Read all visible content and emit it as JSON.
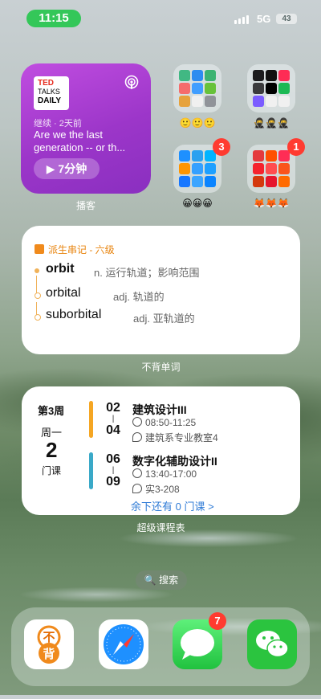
{
  "status_bar": {
    "time": "11:15",
    "network": "5G",
    "battery": "43"
  },
  "podcast_widget": {
    "logo_line1": "TED",
    "logo_line2": "TALKS",
    "logo_line3": "DAILY",
    "subtitle": "继续 · 2天前",
    "title": "Are we the last generation -- or th...",
    "play_label": "▶ 7分钟",
    "label": "播客"
  },
  "folders": [
    {
      "label": "🙂🙂🙂",
      "badge": ""
    },
    {
      "label": "🥷🥷🥷",
      "badge": ""
    },
    {
      "label": "😀😀😀",
      "badge": "3"
    },
    {
      "label": "🦊🦊🦊",
      "badge": "1"
    }
  ],
  "vocab_widget": {
    "header": "派生串记 - 六级",
    "entries": [
      {
        "word": "orbit",
        "definition": "n. 运行轨道；影响范围"
      },
      {
        "word": "orbital",
        "definition": "adj. 轨道的"
      },
      {
        "word": "suborbital",
        "definition": "adj. 亚轨道的"
      }
    ],
    "label": "不背单词"
  },
  "schedule_widget": {
    "week": "第3周",
    "weekday": "周一",
    "course_count": "2",
    "course_unit": "门课",
    "courses": [
      {
        "start": "02",
        "end": "04",
        "name": "建筑设计III",
        "time": "08:50-11:25",
        "location": "建筑系专业教室4",
        "color": "#f5a623"
      },
      {
        "start": "06",
        "end": "09",
        "name": "数字化辅助设计II",
        "time": "13:40-17:00",
        "location": "实3-208",
        "color": "#3aa9c8"
      }
    ],
    "more": "余下还有 0 门课 >",
    "label": "超级课程表"
  },
  "search": {
    "label": "🔍 搜索"
  },
  "dock": {
    "apps": [
      {
        "name": "bubei",
        "text_top": "不",
        "text_bottom": "背",
        "badge": ""
      },
      {
        "name": "safari",
        "badge": ""
      },
      {
        "name": "messages",
        "badge": "7"
      },
      {
        "name": "wechat",
        "badge": ""
      }
    ]
  }
}
